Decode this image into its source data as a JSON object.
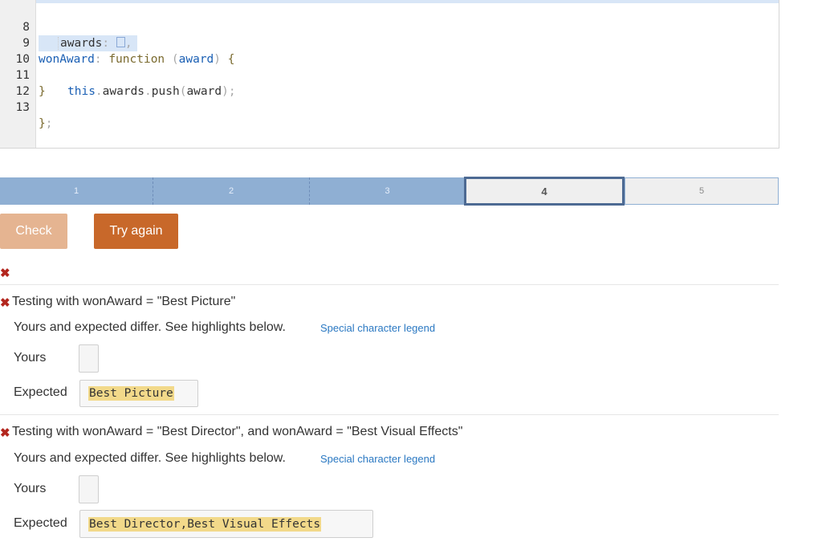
{
  "editor": {
    "lines": [
      {
        "num": "8"
      },
      {
        "num": "9"
      },
      {
        "num": "10"
      },
      {
        "num": "11"
      },
      {
        "num": "12"
      },
      {
        "num": "13"
      }
    ],
    "l8_key": "awards",
    "l8_colon": ":",
    "l8_comma": ",",
    "l9_key": "wonAward",
    "l9_colon": ":",
    "l9_kw": "function",
    "l9_open": "(",
    "l9_param": "award",
    "l9_close": ")",
    "l9_brace": "{",
    "l10_this": "this",
    "l10_dot1": ".",
    "l10_prop": "awards",
    "l10_dot2": ".",
    "l10_fn": "push",
    "l10_open": "(",
    "l10_arg": "award",
    "l10_close": ")",
    "l10_semi": ";",
    "l11_brace": "}",
    "l13_brace": "}",
    "l13_semi": ";"
  },
  "progress": {
    "segments": [
      {
        "label": "1",
        "state": "done"
      },
      {
        "label": "2",
        "state": "done"
      },
      {
        "label": "3",
        "state": "done"
      },
      {
        "label": "4",
        "state": "current"
      },
      {
        "label": "5",
        "state": "todo"
      }
    ]
  },
  "buttons": {
    "check": "Check",
    "try_again": "Try again"
  },
  "results": {
    "status_icon": "✖",
    "tests": [
      {
        "title": "Testing with wonAward = \"Best Picture\"",
        "message": "Yours and expected differ. See highlights below.",
        "legend": "Special character legend",
        "yours_label": "Yours",
        "yours_value": "",
        "expected_label": "Expected",
        "expected_value": "Best Picture"
      },
      {
        "title": "Testing with wonAward = \"Best Director\", and wonAward = \"Best Visual Effects\"",
        "message": "Yours and expected differ. See highlights below.",
        "legend": "Special character legend",
        "yours_label": "Yours",
        "yours_value": "",
        "expected_label": "Expected",
        "expected_value": "Best Director,Best Visual Effects"
      }
    ]
  },
  "colors": {
    "error": "#b3261e",
    "progress_done": "#8fafd3",
    "progress_current_border": "#4d6a93",
    "check_button": "#e5b491",
    "try_again_button": "#c8682a",
    "diff_highlight": "#f2d98a",
    "link": "#2a78c2"
  }
}
